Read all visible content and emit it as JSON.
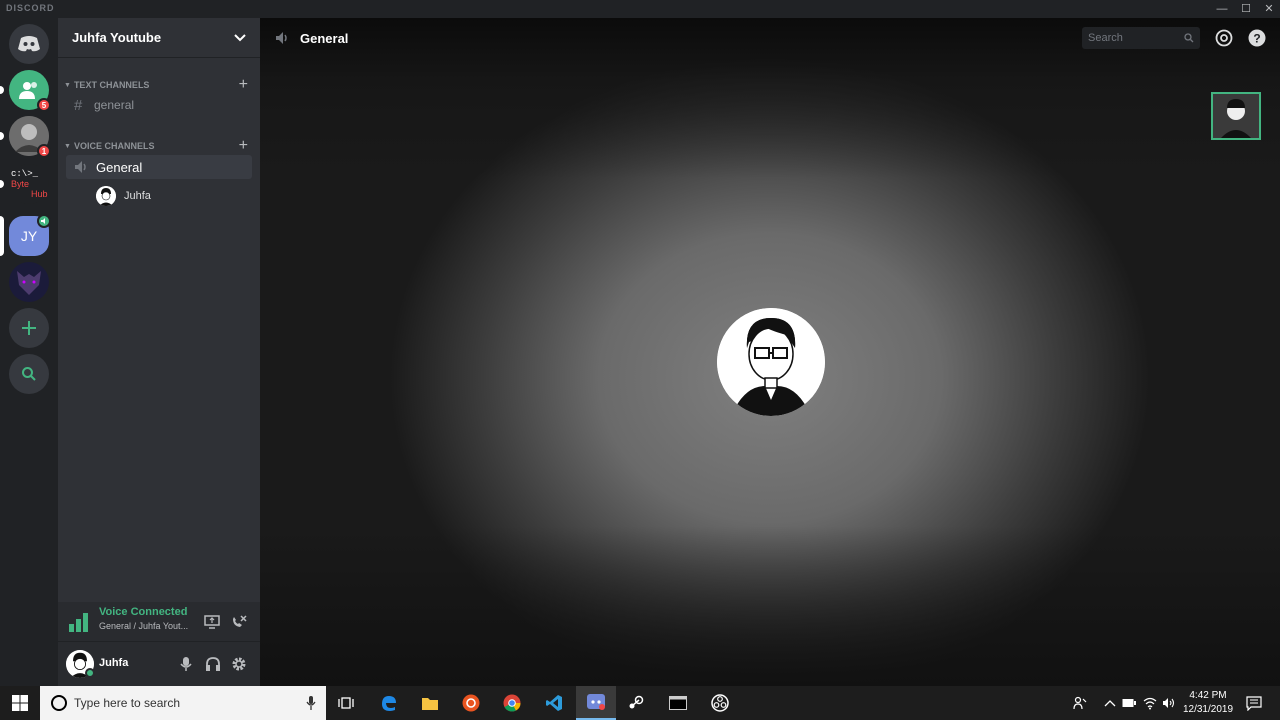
{
  "window": {
    "brand": "DISCORD"
  },
  "guilds": [
    {
      "name": "friends",
      "badge": "5"
    },
    {
      "name": "server-photo",
      "badge": "1"
    },
    {
      "name": "byte-hub",
      "line1": "c:\\>_",
      "line2": "Byte",
      "line3": "Hub"
    },
    {
      "name": "jy",
      "initials": "JY"
    },
    {
      "name": "wolf"
    }
  ],
  "server": {
    "name": "Juhfa Youtube"
  },
  "text_channels": {
    "label": "TEXT CHANNELS",
    "items": [
      {
        "name": "general"
      }
    ]
  },
  "voice_channels": {
    "label": "VOICE CHANNELS",
    "items": [
      {
        "name": "General"
      }
    ],
    "members": [
      {
        "name": "Juhfa"
      }
    ]
  },
  "voice_panel": {
    "title": "Voice Connected",
    "subtitle": "General / Juhfa Yout..."
  },
  "user": {
    "name": "Juhfa"
  },
  "main": {
    "channel_title": "General",
    "search_placeholder": "Search"
  },
  "taskbar": {
    "search_placeholder": "Type here to search",
    "time": "4:42 PM",
    "date": "12/31/2019"
  },
  "colors": {
    "accent": "#43b581",
    "blurple": "#7289da",
    "danger": "#f04747"
  }
}
